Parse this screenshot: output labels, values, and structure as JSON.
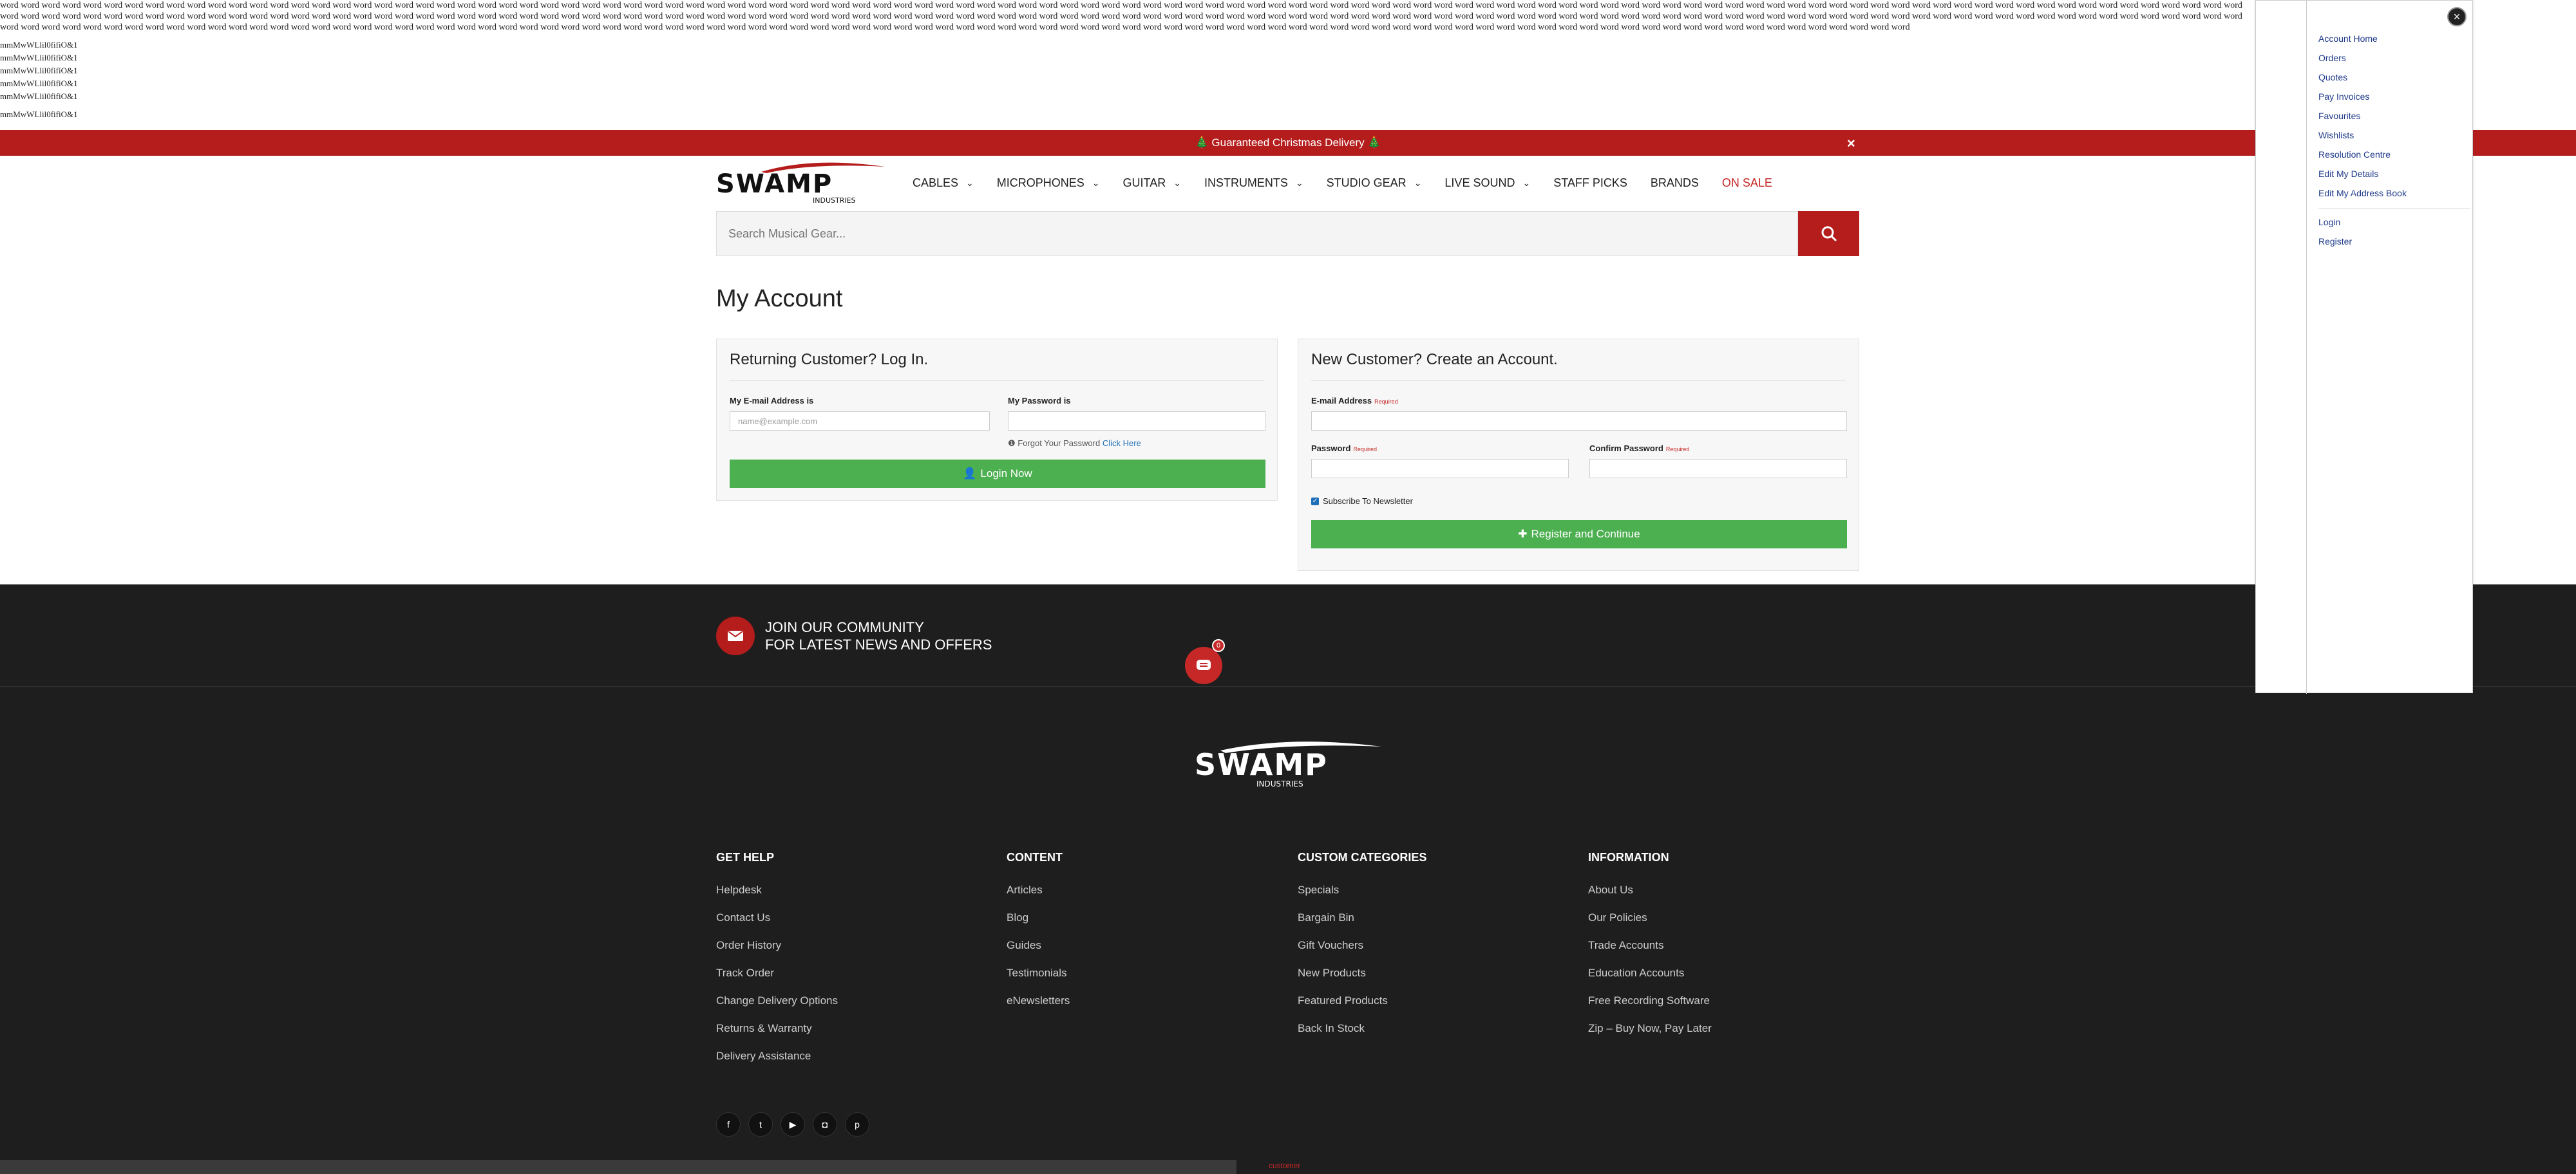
{
  "debug": {
    "words": "word word word word word word word word word word word word word word word word word word word word word word word word word word word word word word word word word word word word word word word word word word word word word word word word word word word word word word word word word word word word word word word word word word word word word word word word word word word word word word word word word word word word word word word word word word word word word word word word word word word word word word word word word word word word word word word word word word word word word word word word word word word word word word word word word word word word word word word word word word word word word word word word word word word word word word word word word word word word word word word word word word word word word word word word word word word word word word word word word word word word word word word word word word word word word word word word word word word word word word word word word word word word word word word word word word word word word word word word word word word word word word word word word word word word word word word word word word word word word word word word word word word word word word word word word word word word word word word word word word word word word word word word word word word word word word word word word word word word word word word word word word word word word word word word word word word word word word word word word word word word word word word word word word word word",
    "lines": [
      "mmMwWLlil0fifiO&1",
      "mmMwWLlil0fifiO&1",
      "mmMwWLlil0fifiO&1",
      "mmMwWLlil0fifiO&1",
      "mmMwWLlil0fifiO&1",
      "mmMwWLlil0fifiO&1"
    ]
  },
  "promo": {
    "text": "🎄 Guaranteed Christmas Delivery 🎄",
    "close": "×"
  },
  "brand": {
    "name": "SWAMP",
    "sub": "INDUSTRIES"
  },
  "nav": [
    {
      "label": "CABLES",
      "dropdown": true
    },
    {
      "label": "MICROPHONES",
      "dropdown": true
    },
    {
      "label": "GUITAR",
      "dropdown": true
    },
    {
      "label": "INSTRUMENTS",
      "dropdown": true
    },
    {
      "label": "STUDIO GEAR",
      "dropdown": true
    },
    {
      "label": "LIVE SOUND",
      "dropdown": true
    },
    {
      "label": "STAFF PICKS",
      "dropdown": false
    },
    {
      "label": "BRANDS",
      "dropdown": false
    },
    {
      "label": "ON SALE",
      "dropdown": false
    }
  ],
  "search": {
    "placeholder": "Search Musical Gear..."
  },
  "page": {
    "title": "My Account"
  },
  "login": {
    "heading": "Returning Customer? Log In.",
    "email_label": "My E-mail Address is",
    "email_placeholder": "name@example.com",
    "password_label": "My Password is",
    "forgot_text": "Forgot Your Password",
    "forgot_link": "Click Here",
    "button": "Login Now"
  },
  "register": {
    "heading": "New Customer? Create an Account.",
    "email_label": "E-mail Address",
    "password_label": "Password",
    "confirm_label": "Confirm Password",
    "required": "Required",
    "subscribe": "Subscribe To Newsletter",
    "button": "Register and Continue"
  },
  "footer": {
    "newsletter_line1": "JOIN OUR COMMUNITY",
    "newsletter_line2": "FOR LATEST NEWS AND OFFERS",
    "chat_badge": "0",
    "columns": [
      {
        "title": "GET HELP",
        "links": [
          "Helpdesk",
          "Contact Us",
          "Order History",
          "Track Order",
          "Change Delivery Options",
          "Returns & Warranty",
          "Delivery Assistance"
        ]
      },
      {
        "title": "CONTENT",
        "links": [
          "Articles",
          "Blog",
          "Guides",
          "Testimonials",
          "eNewsletters"
        ]
      },
      {
        "title": "CUSTOM CATEGORIES",
        "links": [
          "Specials",
          "Bargain Bin",
          "Gift Vouchers",
          "New Products",
          "Featured Products",
          "Back In Stock"
        ]
      },
      {
        "title": "INFORMATION",
        "links": [
          "About Us",
          "Our Policies",
          "Trade Accounts",
          "Education Accounts",
          "Free Recording Software",
          "Zip – Buy Now, Pay Later"
        ]
      }
    ],
    "social": [
      "facebook-icon",
      "twitter-icon",
      "youtube-icon",
      "instagram-icon",
      "pinterest-icon"
    ],
    "bottom_text": "customer"
  },
  "account_menu": {
    "close": "×",
    "items": [
      "Account Home",
      "Orders",
      "Quotes",
      "Pay Invoices",
      "Favourites",
      "Wishlists",
      "Resolution Centre",
      "Edit My Details",
      "Edit My Address Book"
    ],
    "auth": [
      "Login",
      "Register"
    ]
  },
  "colors": {
    "brand_red": "#b51d1d",
    "green": "#4caf50",
    "footer_bg": "#1e1e1e"
  }
}
